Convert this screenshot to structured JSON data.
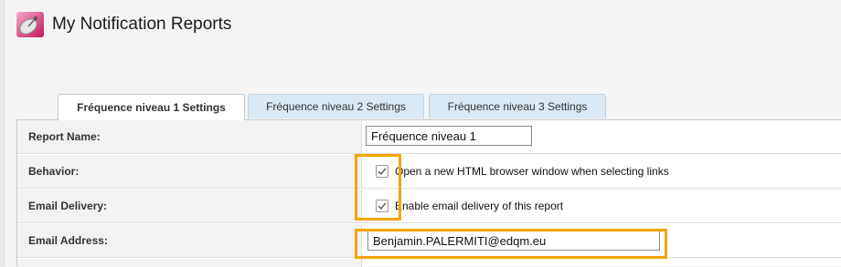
{
  "app": {
    "title": "My Notification Reports",
    "icon": "satellite-dish-icon"
  },
  "tabs": [
    {
      "label": "Fréquence niveau 1 Settings",
      "active": true
    },
    {
      "label": "Fréquence niveau 2 Settings",
      "active": false
    },
    {
      "label": "Fréquence niveau 3 Settings",
      "active": false
    }
  ],
  "form": {
    "report_name": {
      "label": "Report Name:",
      "value": "Fréquence niveau 1"
    },
    "behavior": {
      "label": "Behavior:",
      "checkbox_label": "Open a new HTML browser window when selecting links",
      "checked": true
    },
    "email_delivery": {
      "label": "Email Delivery:",
      "checkbox_label": "Enable email delivery of this report",
      "checked": true
    },
    "email_address": {
      "label": "Email Address:",
      "value": "Benjamin.PALERMITI@edqm.eu"
    }
  },
  "colors": {
    "highlight": "#f5a500",
    "tab_inactive_bg": "#dbe9f4",
    "label_bg": "#f2f2f2"
  }
}
